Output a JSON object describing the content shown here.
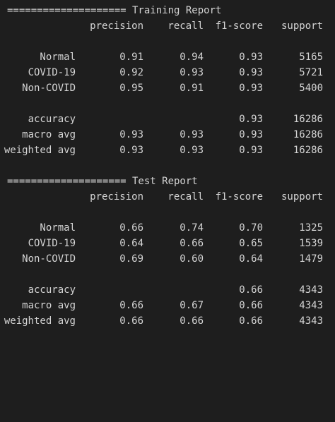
{
  "reports": [
    {
      "header": "==================== Training Report",
      "columns": [
        "precision",
        "recall",
        "f1-score",
        "support"
      ],
      "class_rows": [
        {
          "label": "Normal",
          "precision": "0.91",
          "recall": "0.94",
          "f1": "0.93",
          "support": "5165"
        },
        {
          "label": "COVID-19",
          "precision": "0.92",
          "recall": "0.93",
          "f1": "0.93",
          "support": "5721"
        },
        {
          "label": "Non-COVID",
          "precision": "0.95",
          "recall": "0.91",
          "f1": "0.93",
          "support": "5400"
        }
      ],
      "summary_rows": [
        {
          "label": "accuracy",
          "precision": "",
          "recall": "",
          "f1": "0.93",
          "support": "16286"
        },
        {
          "label": "macro avg",
          "precision": "0.93",
          "recall": "0.93",
          "f1": "0.93",
          "support": "16286"
        },
        {
          "label": "weighted avg",
          "precision": "0.93",
          "recall": "0.93",
          "f1": "0.93",
          "support": "16286"
        }
      ]
    },
    {
      "header": "==================== Test Report",
      "columns": [
        "precision",
        "recall",
        "f1-score",
        "support"
      ],
      "class_rows": [
        {
          "label": "Normal",
          "precision": "0.66",
          "recall": "0.74",
          "f1": "0.70",
          "support": "1325"
        },
        {
          "label": "COVID-19",
          "precision": "0.64",
          "recall": "0.66",
          "f1": "0.65",
          "support": "1539"
        },
        {
          "label": "Non-COVID",
          "precision": "0.69",
          "recall": "0.60",
          "f1": "0.64",
          "support": "1479"
        }
      ],
      "summary_rows": [
        {
          "label": "accuracy",
          "precision": "",
          "recall": "",
          "f1": "0.66",
          "support": "4343"
        },
        {
          "label": "macro avg",
          "precision": "0.66",
          "recall": "0.67",
          "f1": "0.66",
          "support": "4343"
        },
        {
          "label": "weighted avg",
          "precision": "0.66",
          "recall": "0.66",
          "f1": "0.66",
          "support": "4343"
        }
      ]
    }
  ]
}
